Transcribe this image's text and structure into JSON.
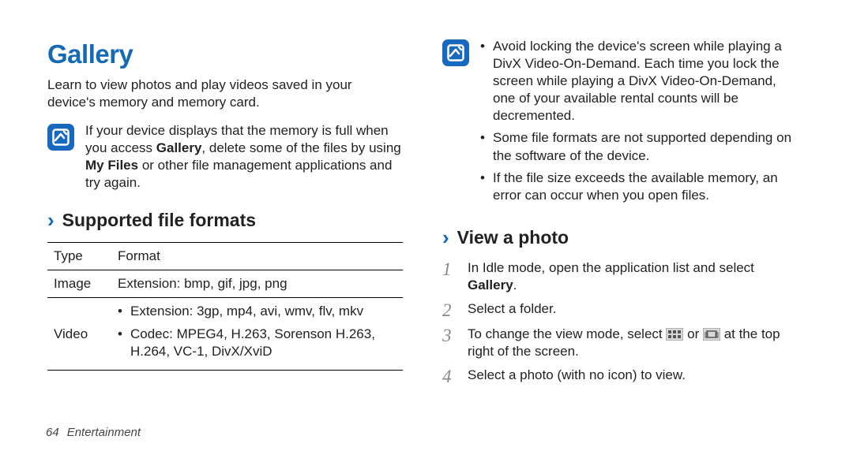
{
  "left": {
    "title": "Gallery",
    "intro": "Learn to view photos and play videos saved in your device's memory and memory card.",
    "note": {
      "text_before": "If your device displays that the memory is full when you access ",
      "bold1": "Gallery",
      "text_mid": ", delete some of the files by using ",
      "bold2": "My Files",
      "text_after": " or other file management applications and try again."
    },
    "sub1": "Supported file formats",
    "table": {
      "head_type": "Type",
      "head_format": "Format",
      "row1_type": "Image",
      "row1_format": "Extension: bmp, gif, jpg, png",
      "row2_type": "Video",
      "row2_b1": "Extension: 3gp, mp4, avi, wmv, flv, mkv",
      "row2_b2": "Codec: MPEG4, H.263, Sorenson H.263, H.264, VC-1, DivX/XviD"
    }
  },
  "right": {
    "note_bullets": {
      "b1": "Avoid locking the device's screen while playing a DivX Video-On-Demand. Each time you lock the screen while playing a DivX Video-On-Demand, one of your available rental counts will be decremented.",
      "b2": "Some file formats are not supported depending on the software of the device.",
      "b3": "If the file size exceeds the available memory, an error can occur when you open files."
    },
    "sub2": "View a photo",
    "steps": {
      "s1_before": "In Idle mode, open the application list and select ",
      "s1_bold": "Gallery",
      "s1_after": ".",
      "s2": "Select a folder.",
      "s3_before": "To change the view mode, select ",
      "s3_mid": " or ",
      "s3_after": " at the top right of the screen.",
      "s4": "Select a photo (with no icon) to view."
    }
  },
  "chart_data": {
    "type": "table",
    "title": "Supported file formats",
    "columns": [
      "Type",
      "Format"
    ],
    "rows": [
      {
        "Type": "Image",
        "Format": "Extension: bmp, gif, jpg, png"
      },
      {
        "Type": "Video",
        "Format": [
          "Extension: 3gp, mp4, avi, wmv, flv, mkv",
          "Codec: MPEG4, H.263, Sorenson H.263, H.264, VC-1, DivX/XviD"
        ]
      }
    ]
  },
  "footer": {
    "page": "64",
    "section": "Entertainment"
  }
}
